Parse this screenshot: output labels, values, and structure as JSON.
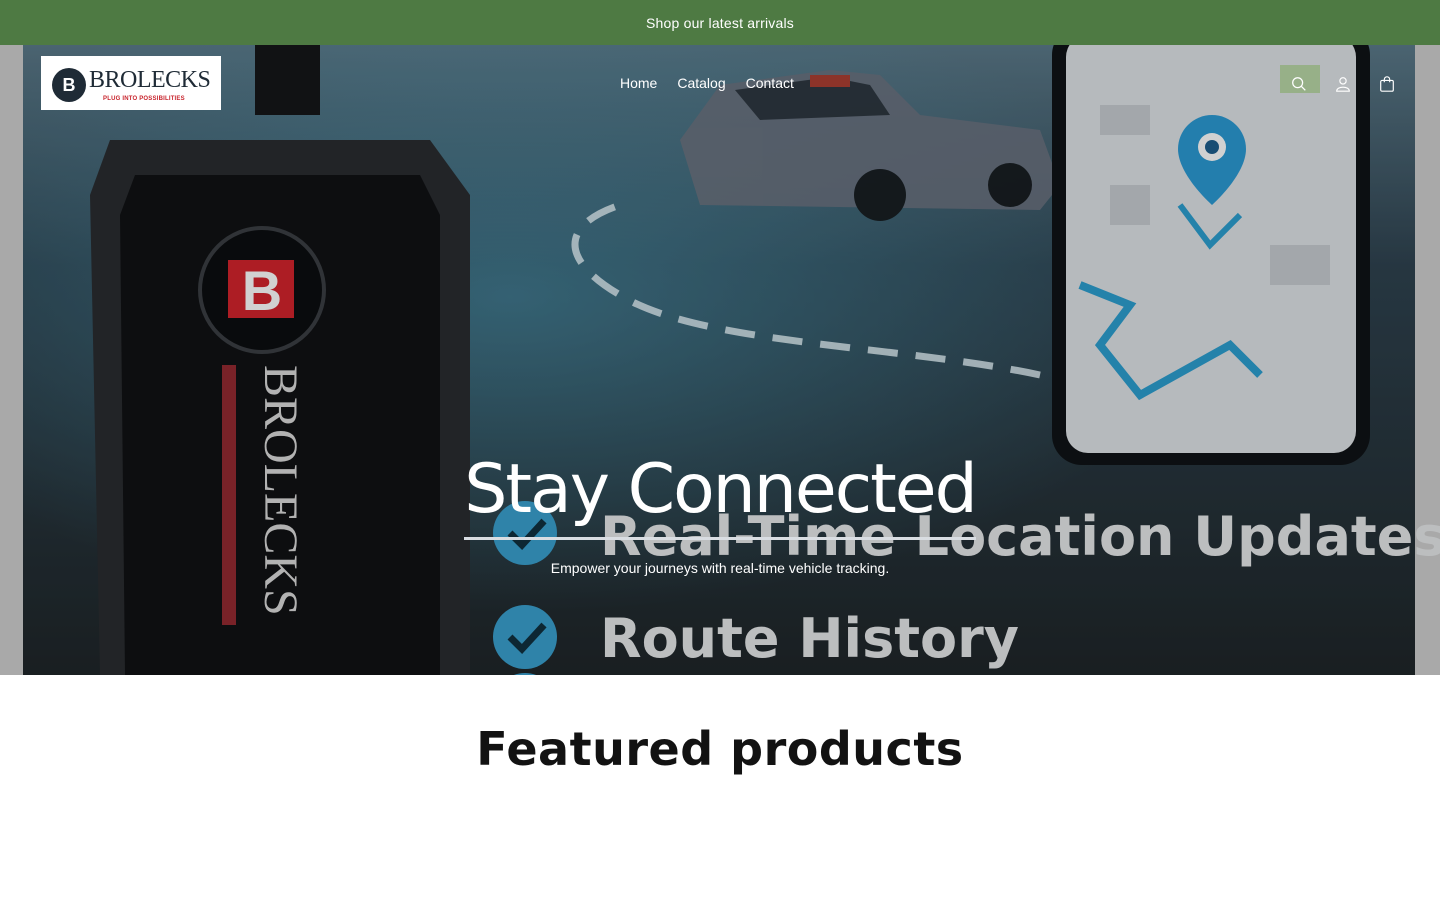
{
  "announcement": {
    "text": "Shop our latest arrivals"
  },
  "header": {
    "logo": {
      "brand": "BROLECKS",
      "tagline": "PLUG INTO POSSIBILITIES"
    },
    "nav": [
      {
        "label": "Home"
      },
      {
        "label": "Catalog"
      },
      {
        "label": "Contact"
      }
    ],
    "icons": [
      "search-icon",
      "account-icon",
      "cart-icon"
    ]
  },
  "hero": {
    "image_text": {
      "device_brand": "BROLECKS",
      "feature_1": "Real-Time Location Updates",
      "feature_2": "Route History"
    },
    "title": "Stay Connected",
    "subtitle": "Empower your journeys with real-time vehicle tracking."
  },
  "featured": {
    "title": "Featured products"
  },
  "colors": {
    "announcement_bg": "#4e7a43",
    "brand_red": "#c8232c",
    "brand_dark": "#1f2b36"
  }
}
